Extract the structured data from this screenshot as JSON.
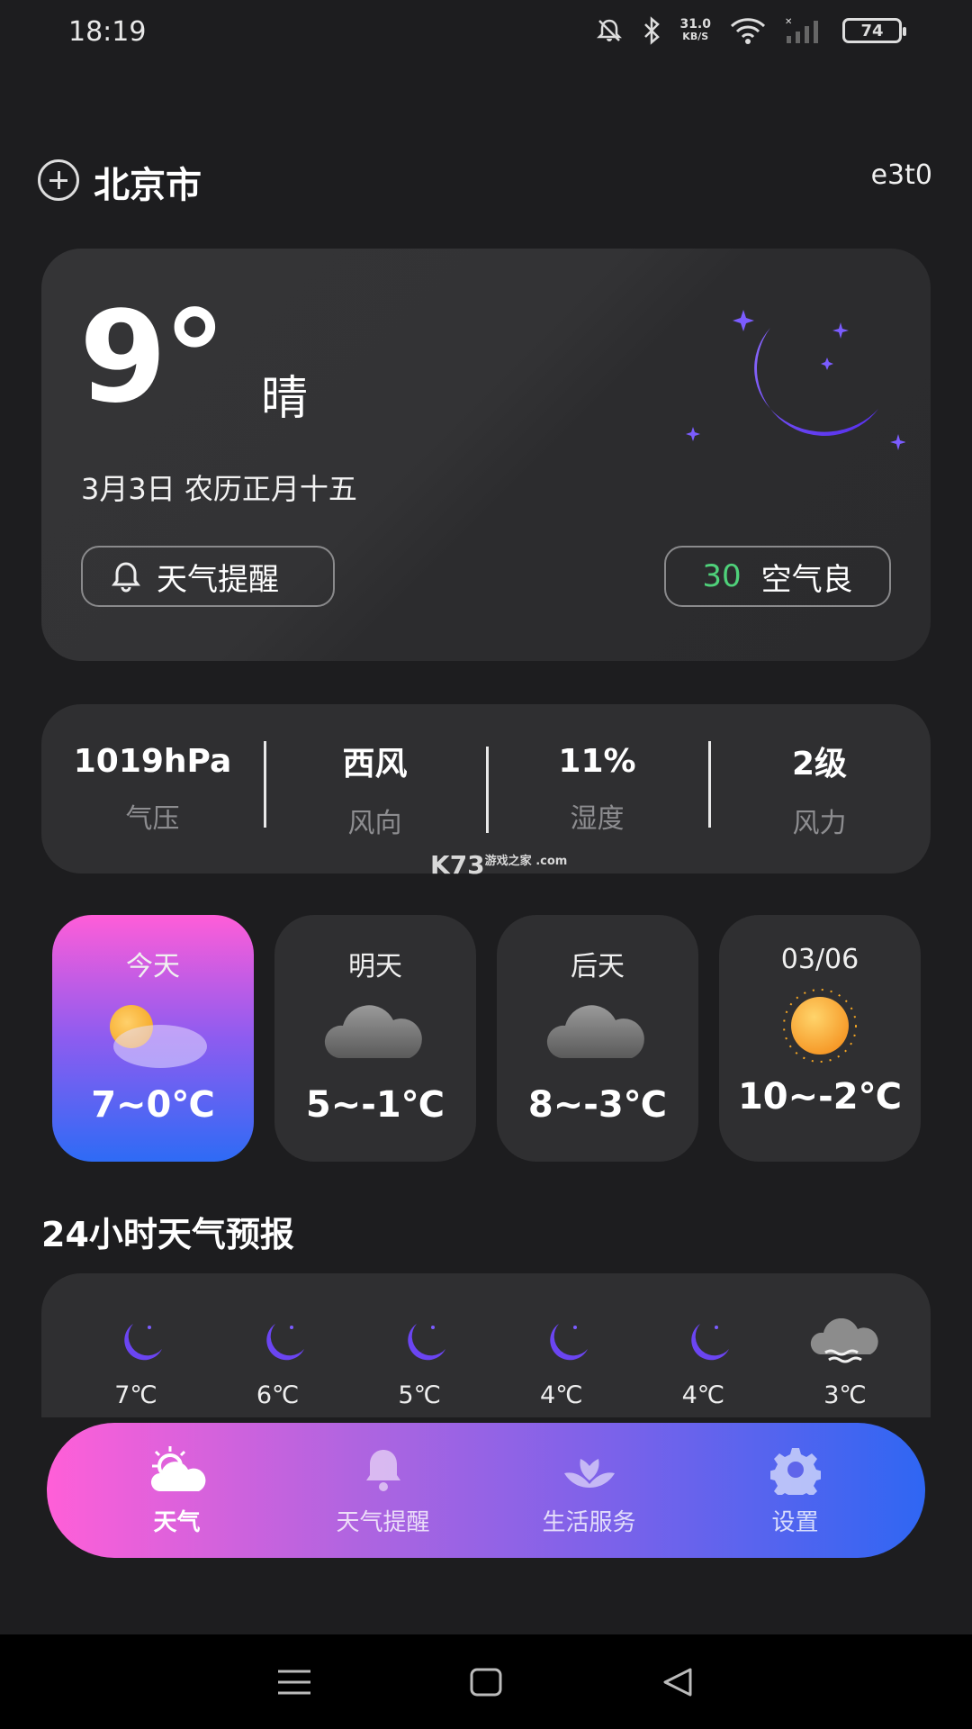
{
  "status_bar": {
    "time": "18:19",
    "net_speed_value": "31.0",
    "net_speed_unit": "KB/S",
    "battery": "74"
  },
  "header": {
    "city": "北京市",
    "right_text": "e3t0"
  },
  "current": {
    "temperature": "9°",
    "condition": "晴",
    "date": "3月3日 农历正月十五",
    "remind_label": "天气提醒",
    "aqi_value": "30",
    "aqi_label": "空气良"
  },
  "details": [
    {
      "value": "1019hPa",
      "label": "气压"
    },
    {
      "value": "西风",
      "label": "风向"
    },
    {
      "value": "11%",
      "label": "湿度"
    },
    {
      "value": "2级",
      "label": "风力"
    }
  ],
  "watermark": {
    "main": "K73",
    "sub": "游戏之家",
    "domain": ".com"
  },
  "days": [
    {
      "name": "今天",
      "temp": "7~0℃",
      "icon": "partly-cloudy-icon"
    },
    {
      "name": "明天",
      "temp": "5~-1℃",
      "icon": "cloud-icon"
    },
    {
      "name": "后天",
      "temp": "8~-3℃",
      "icon": "cloud-icon"
    },
    {
      "name": "03/06",
      "temp": "10~-2℃",
      "icon": "sun-icon"
    }
  ],
  "hourly_title": "24小时天气预报",
  "hourly": [
    {
      "temp": "7℃",
      "icon": "moon-icon"
    },
    {
      "temp": "6℃",
      "icon": "moon-icon"
    },
    {
      "temp": "5℃",
      "icon": "moon-icon"
    },
    {
      "temp": "4℃",
      "icon": "moon-icon"
    },
    {
      "temp": "4℃",
      "icon": "moon-icon"
    },
    {
      "temp": "3℃",
      "icon": "fog-icon"
    }
  ],
  "tabs": [
    {
      "label": "天气",
      "icon": "weather-icon",
      "active": true
    },
    {
      "label": "天气提醒",
      "icon": "bell-icon",
      "active": false
    },
    {
      "label": "生活服务",
      "icon": "lotus-icon",
      "active": false
    },
    {
      "label": "设置",
      "icon": "gear-icon",
      "active": false
    }
  ],
  "colors": {
    "background": "#1d1d1f",
    "card": "#2f2f31",
    "aqi_good": "#4fd17a",
    "accent_pink": "#ff5dd8",
    "accent_blue": "#2e6bf5",
    "moon_purple": "#6b45f2"
  }
}
